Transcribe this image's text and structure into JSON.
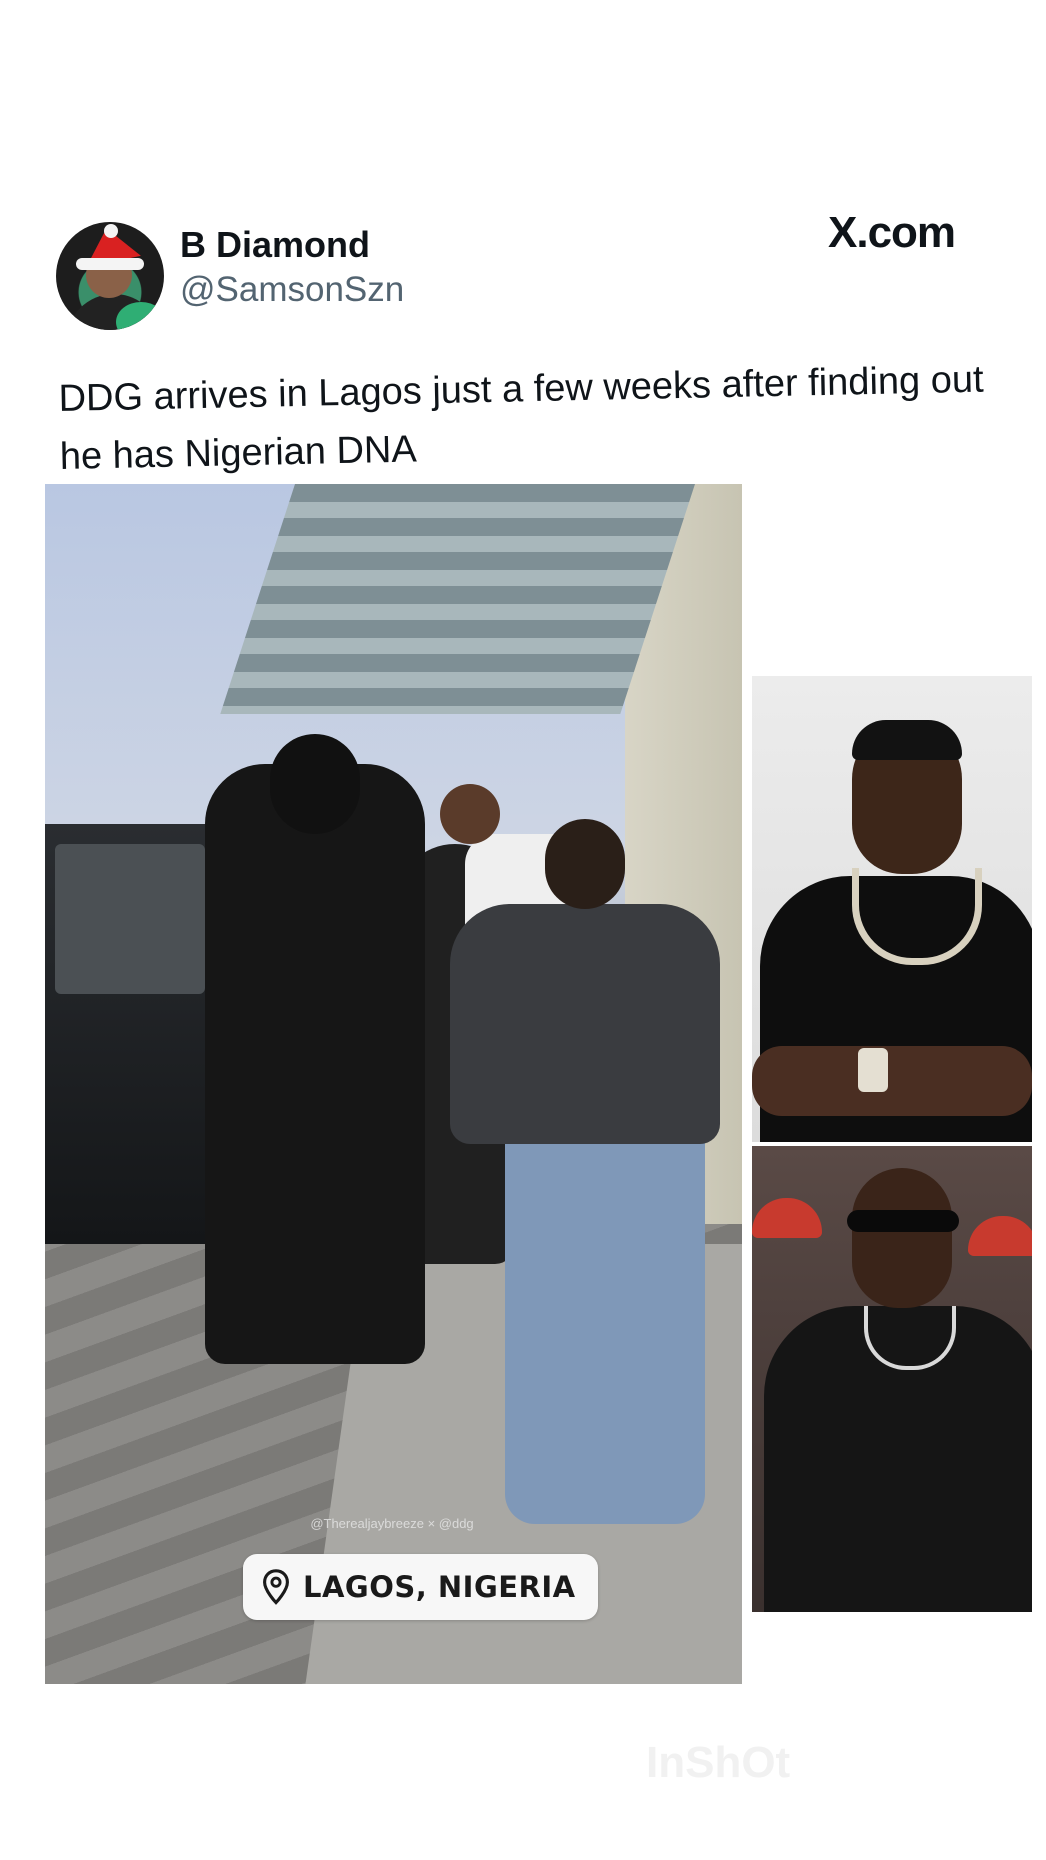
{
  "tweet": {
    "display_name": "B Diamond",
    "handle": "@SamsonSzn",
    "source_label": "X.com",
    "text": "DDG arrives in Lagos just a few weeks after finding out he has Nigerian DNA"
  },
  "media": {
    "main_video": {
      "location_sticker": "LAGOS, NIGERIA",
      "mention_tags": "@Therealjaybreeze × @ddg"
    }
  },
  "watermark": "InShOt",
  "icons": {
    "location": "location-pin-icon"
  }
}
